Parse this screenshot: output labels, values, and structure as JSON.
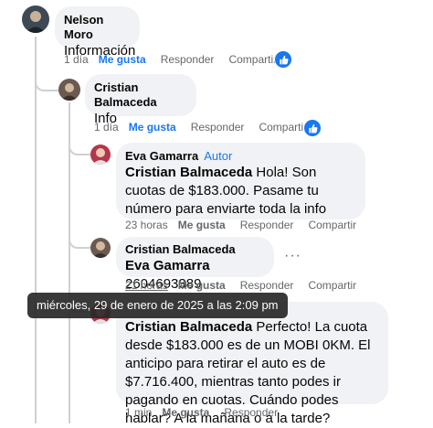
{
  "colors": {
    "accent": "#1877f2",
    "bubble": "#f0f2f5",
    "muted": "#65676b"
  },
  "comments": [
    {
      "author": "Nelson Moro",
      "text": "Información",
      "time": "1 día",
      "like": "Me gusta",
      "reply": "Responder",
      "share": "Compartir"
    },
    {
      "author": "Cristian Balmaceda",
      "text": "Info",
      "time": "1 día",
      "like": "Me gusta",
      "reply": "Responder",
      "share": "Compartir"
    },
    {
      "author": "Eva Gamarra",
      "badge": "Autor",
      "mention": "Cristian Balmaceda",
      "text": "Hola! Son cuotas de $183.000. Pasame tu número para enviarte toda la info",
      "time": "23 horas",
      "like": "Me gusta",
      "reply": "Responder",
      "share": "Compartir"
    },
    {
      "author": "Cristian Balmaceda",
      "mention": "Eva Gamarra",
      "text": "2604693389",
      "time": "21 horas",
      "like": "Me gusta",
      "reply": "Responder",
      "share": "Compartir",
      "more": "···"
    },
    {
      "author": "Eva Gamarra",
      "mention": "Cristian Balmaceda",
      "text": "Perfecto! La cuota desde $183.000 es de un MOBI 0KM. El anticipo para retirar el auto es de $7.716.400, mientras tanto podes ir pagando en cuotas. Cuándo podes hablar? A la mañana o a la tarde?",
      "time": "1 min",
      "like": "Me gusta",
      "reply": "Responder"
    }
  ],
  "tooltip": "miércoles, 29 de enero de 2025 a las 2:09 pm"
}
